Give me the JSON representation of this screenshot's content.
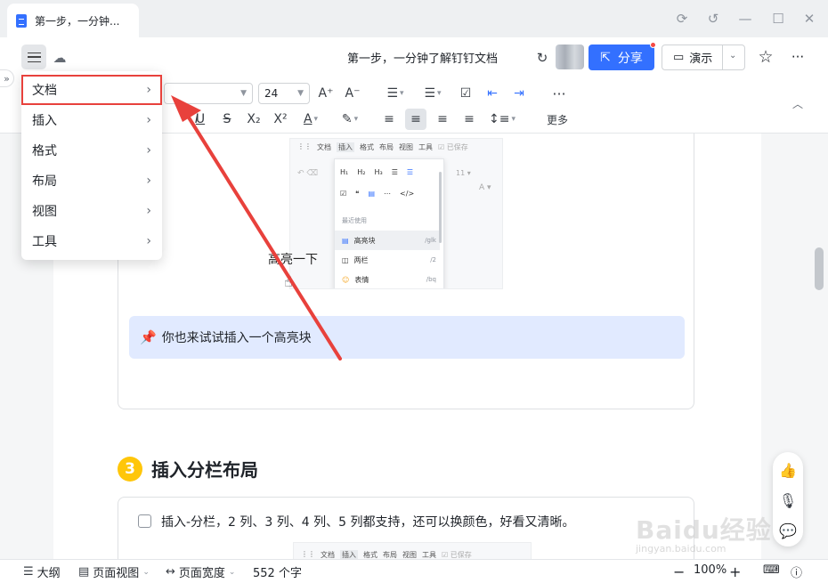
{
  "window": {
    "tab_title": "第一步，一分钟...",
    "controls": [
      "settings-icon",
      "history-icon",
      "minimize-icon",
      "maximize-icon",
      "close-icon"
    ]
  },
  "header": {
    "doc_title": "第一步，一分钟了解钉钉文档",
    "share_label": "分享",
    "present_label": "演示"
  },
  "toolbar": {
    "font_family": "",
    "font_size": "24",
    "more_label": "更多"
  },
  "dropdown": {
    "items": [
      {
        "label": "文档"
      },
      {
        "label": "插入"
      },
      {
        "label": "格式"
      },
      {
        "label": "布局"
      },
      {
        "label": "视图"
      },
      {
        "label": "工具"
      }
    ]
  },
  "content": {
    "screenshot1": {
      "menu": [
        "文档",
        "插入",
        "格式",
        "布局",
        "视图",
        "工具"
      ],
      "saved": "已保存",
      "headings": [
        "H₁",
        "H₂",
        "H₃"
      ],
      "recent_label": "最近使用",
      "items": [
        {
          "label": "高亮块",
          "shortcut": "/glk"
        },
        {
          "label": "两栏",
          "shortcut": "/2"
        },
        {
          "label": "表情",
          "shortcut": "/bq"
        }
      ],
      "font_size": "11",
      "handwriting": "高亮一下"
    },
    "callout_text": "你也来试试插入一个高亮块",
    "section_number": "3",
    "section_heading": "插入分栏布局",
    "check_text": "插入-分栏，2 列、3 列、4 列、5 列都支持，还可以换颜色，好看又清晰。",
    "screenshot2": {
      "menu": [
        "文档",
        "插入",
        "格式",
        "布局",
        "视图",
        "工具"
      ],
      "saved": "已保存"
    }
  },
  "statusbar": {
    "outline": "大纲",
    "page_view": "页面视图",
    "page_width": "页面宽度",
    "word_count": "552 个字",
    "zoom": "100%"
  },
  "watermark": {
    "main": "Baidu经验",
    "sub": "jingyan.baidu.com"
  },
  "colors": {
    "accent": "#3370ff",
    "highlight_box": "#e8413c",
    "callout_bg": "#e1eaff"
  }
}
